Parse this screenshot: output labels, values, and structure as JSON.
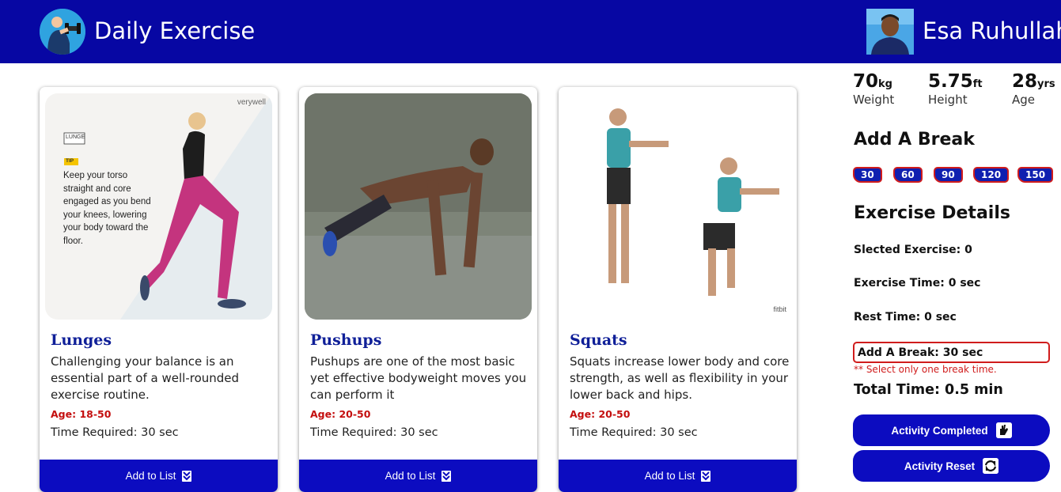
{
  "header": {
    "app_title": "Daily Exercise",
    "user_name": "Esa Ruhullah",
    "logo_icon": "dumbbell-person-icon",
    "avatar_icon": "user-avatar"
  },
  "colors": {
    "primary": "#0707a3",
    "button": "#0c0cc0",
    "accent_red": "#d01c1c",
    "title_blue": "#0f1f98"
  },
  "exercises": [
    {
      "title": "Lunges",
      "description": "Challenging your balance is an essential part of a well-rounded exercise routine.",
      "age": "Age: 18-50",
      "time": "Time Required: 30 sec",
      "button_label": "Add to List",
      "image_text": {
        "brand": "verywell",
        "tag": "LUNGE",
        "tip_label": "TIP",
        "tip_text": "Keep your torso straight and core engaged as you bend your knees, lowering your body toward the floor."
      }
    },
    {
      "title": "Pushups",
      "description": "Pushups are one of the most basic yet effective bodyweight moves you can perform it",
      "age": "Age: 20-50",
      "time": "Time Required: 30 sec",
      "button_label": "Add to List"
    },
    {
      "title": "Squats",
      "description": "Squats increase lower body and core strength, as well as flexibility in your lower back and hips.",
      "age": "Age: 20-50",
      "time": "Time Required: 30 sec",
      "button_label": "Add to List",
      "image_text": {
        "brand": "fitbit"
      }
    }
  ],
  "profile": {
    "weight": {
      "value": "70",
      "unit": "kg",
      "label": "Weight"
    },
    "height": {
      "value": "5.75",
      "unit": "ft",
      "label": "Height"
    },
    "age": {
      "value": "28",
      "unit": "yrs",
      "label": "Age"
    }
  },
  "break_section": {
    "heading": "Add A Break",
    "options": [
      "30",
      "60",
      "90",
      "120",
      "150"
    ]
  },
  "details": {
    "heading": "Exercise Details",
    "selected": "Slected Exercise: 0",
    "exercise_time": "Exercise Time: 0 sec",
    "rest_time": "Rest Time: 0 sec",
    "break_value": "Add A Break: 30 sec",
    "warning": "** Select only one break time.",
    "total": "Total Time: 0.5 min"
  },
  "actions": {
    "completed_label": "Activity Completed",
    "reset_label": "Activity Reset"
  }
}
